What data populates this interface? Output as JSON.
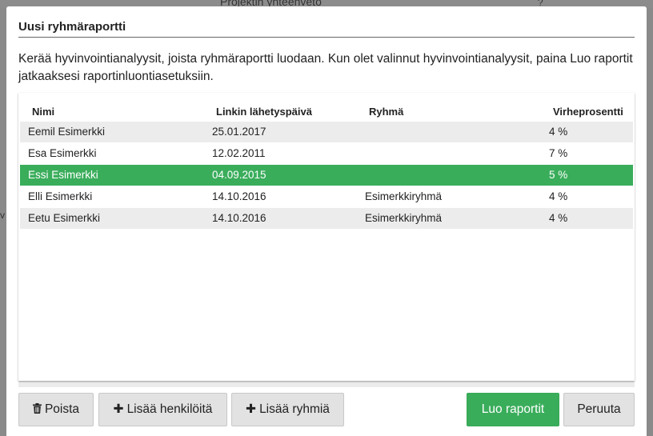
{
  "backdrop": {
    "top_text": "Projektin yhteenveto",
    "top_mark": "?",
    "side_text": "v"
  },
  "modal": {
    "title": "Uusi ryhmäraportti",
    "intro": "Kerää hyvinvointianalyysit, joista ryhmäraportti luodaan. Kun olet valinnut hyvinvointianalyysit, paina Luo raportit jatkaaksesi raportinluontiasetuksiin."
  },
  "table": {
    "headers": {
      "name": "Nimi",
      "date": "Linkin lähetyspäivä",
      "group": "Ryhmä",
      "error": "Virheprosentti"
    },
    "rows": [
      {
        "name": "Eemil Esimerkki",
        "date": "25.01.2017",
        "group": "",
        "error": "4 %"
      },
      {
        "name": "Esa Esimerkki",
        "date": "12.02.2011",
        "group": "",
        "error": "7 %"
      },
      {
        "name": "Essi Esimerkki",
        "date": "04.09.2015",
        "group": "",
        "error": "5 %"
      },
      {
        "name": "Elli Esimerkki",
        "date": "14.10.2016",
        "group": "Esimerkkiryhmä",
        "error": "4 %"
      },
      {
        "name": "Eetu Esimerkki",
        "date": "14.10.2016",
        "group": "Esimerkkiryhmä",
        "error": "4 %"
      }
    ],
    "selected_row": 2
  },
  "buttons": {
    "delete": {
      "label": "Poista",
      "icon": "trash-icon"
    },
    "add_persons": {
      "label": "Lisää henkilöitä",
      "icon": "plus-icon"
    },
    "add_groups": {
      "label": "Lisää ryhmiä",
      "icon": "plus-icon"
    },
    "create": {
      "label": "Luo raportit"
    },
    "cancel": {
      "label": "Peruuta"
    }
  },
  "colors": {
    "accent_green": "#3aad5b",
    "button_gray": "#e2e2e2",
    "stripe_gray": "#ececec"
  }
}
